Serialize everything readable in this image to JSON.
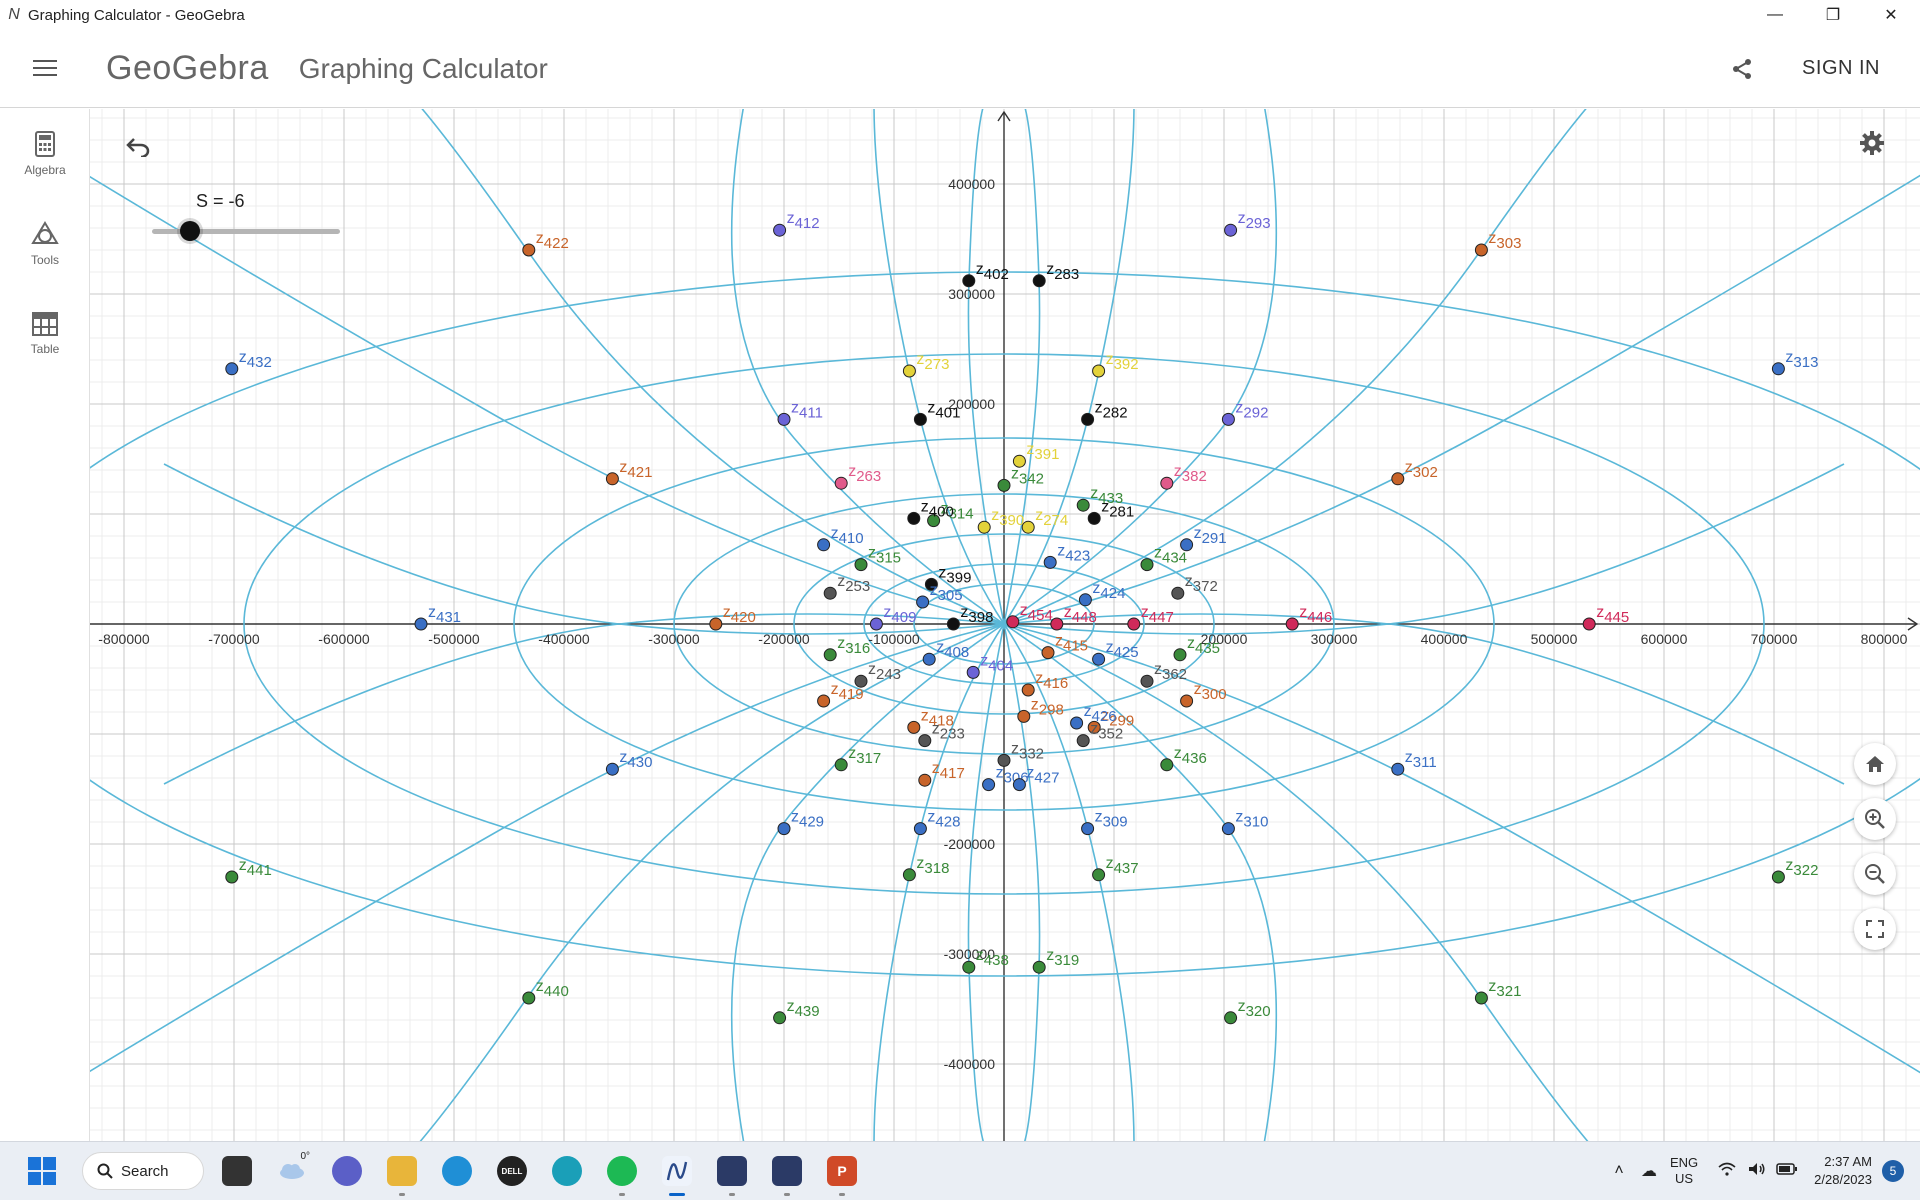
{
  "window": {
    "title": "Graphing Calculator - GeoGebra",
    "app_glyph": "N"
  },
  "header": {
    "brand": "GeoGebra",
    "app_name": "Graphing Calculator",
    "signin_label": "SIGN IN"
  },
  "sidebar": {
    "items": [
      {
        "label": "Algebra",
        "icon": "calculator-icon"
      },
      {
        "label": "Tools",
        "icon": "tools-icon"
      },
      {
        "label": "Table",
        "icon": "table-icon"
      }
    ]
  },
  "slider": {
    "label": "S = -6",
    "value": -6,
    "min": -10,
    "max": 10
  },
  "axes": {
    "x_ticks": [
      "-800000",
      "-700000",
      "-600000",
      "-500000",
      "-400000",
      "-300000",
      "-200000",
      "-100000",
      "200000",
      "300000",
      "400000",
      "500000",
      "600000",
      "700000",
      "800000"
    ],
    "y_ticks": [
      "400000",
      "300000",
      "200000",
      "-200000",
      "-300000",
      "-400000"
    ]
  },
  "points": [
    {
      "label": "z",
      "sub": "412",
      "x": -204000,
      "y": 358000,
      "color": "#6b63d6"
    },
    {
      "label": "z",
      "sub": "422",
      "x": -432000,
      "y": 340000,
      "color": "#c8642a"
    },
    {
      "label": "z",
      "sub": "432",
      "x": -702000,
      "y": 232000,
      "color": "#3a6fc4"
    },
    {
      "label": "z",
      "sub": "421",
      "x": -356000,
      "y": 132000,
      "color": "#c8642a"
    },
    {
      "label": "z",
      "sub": "431",
      "x": -530000,
      "y": 0,
      "color": "#3a6fc4"
    },
    {
      "label": "z",
      "sub": "420",
      "x": -262000,
      "y": 0,
      "color": "#c8642a"
    },
    {
      "label": "z",
      "sub": "430",
      "x": -356000,
      "y": -132000,
      "color": "#3a6fc4"
    },
    {
      "label": "z",
      "sub": "441",
      "x": -702000,
      "y": -230000,
      "color": "#3a8a3a"
    },
    {
      "label": "z",
      "sub": "440",
      "x": -432000,
      "y": -340000,
      "color": "#3a8a3a"
    },
    {
      "label": "z",
      "sub": "439",
      "x": -204000,
      "y": -358000,
      "color": "#3a8a3a"
    },
    {
      "label": "z",
      "sub": "429",
      "x": -200000,
      "y": -186000,
      "color": "#3a6fc4"
    },
    {
      "label": "z",
      "sub": "411",
      "x": -200000,
      "y": 186000,
      "color": "#6b63d6"
    },
    {
      "label": "z",
      "sub": "402",
      "x": -32000,
      "y": 312000,
      "color": "#111111"
    },
    {
      "label": "z",
      "sub": "283",
      "x": 32000,
      "y": 312000,
      "color": "#111111"
    },
    {
      "label": "z",
      "sub": "293",
      "x": 206000,
      "y": 358000,
      "color": "#6b63d6"
    },
    {
      "label": "z",
      "sub": "303",
      "x": 434000,
      "y": 340000,
      "color": "#c8642a"
    },
    {
      "label": "z",
      "sub": "313",
      "x": 704000,
      "y": 232000,
      "color": "#3a6fc4"
    },
    {
      "label": "z",
      "sub": "292",
      "x": 204000,
      "y": 186000,
      "color": "#6b63d6"
    },
    {
      "label": "z",
      "sub": "302",
      "x": 358000,
      "y": 132000,
      "color": "#c8642a"
    },
    {
      "label": "z",
      "sub": "446",
      "x": 262000,
      "y": 0,
      "color": "#d02a5a"
    },
    {
      "label": "z",
      "sub": "445",
      "x": 532000,
      "y": 0,
      "color": "#d02a5a"
    },
    {
      "label": "z",
      "sub": "311",
      "x": 358000,
      "y": -132000,
      "color": "#3a6fc4"
    },
    {
      "label": "z",
      "sub": "322",
      "x": 704000,
      "y": -230000,
      "color": "#3a8a3a"
    },
    {
      "label": "z",
      "sub": "321",
      "x": 434000,
      "y": -340000,
      "color": "#3a8a3a"
    },
    {
      "label": "z",
      "sub": "320",
      "x": 206000,
      "y": -358000,
      "color": "#3a8a3a"
    },
    {
      "label": "z",
      "sub": "310",
      "x": 204000,
      "y": -186000,
      "color": "#3a6fc4"
    },
    {
      "label": "z",
      "sub": "438",
      "x": -32000,
      "y": -312000,
      "color": "#3a8a3a"
    },
    {
      "label": "z",
      "sub": "319",
      "x": 32000,
      "y": -312000,
      "color": "#3a8a3a"
    },
    {
      "label": "z",
      "sub": "273",
      "x": -86000,
      "y": 230000,
      "color": "#e3d23a"
    },
    {
      "label": "z",
      "sub": "392",
      "x": 86000,
      "y": 230000,
      "color": "#e3d23a"
    },
    {
      "label": "z",
      "sub": "401",
      "x": -76000,
      "y": 186000,
      "color": "#111111"
    },
    {
      "label": "z",
      "sub": "282",
      "x": 76000,
      "y": 186000,
      "color": "#111111"
    },
    {
      "label": "z",
      "sub": "263",
      "x": -148000,
      "y": 128000,
      "color": "#e05a8a"
    },
    {
      "label": "z",
      "sub": "382",
      "x": 148000,
      "y": 128000,
      "color": "#e05a8a"
    },
    {
      "label": "z",
      "sub": "391",
      "x": 14000,
      "y": 148000,
      "color": "#e3d23a"
    },
    {
      "label": "z",
      "sub": "342",
      "x": 0,
      "y": 126000,
      "color": "#3a8a3a"
    },
    {
      "label": "z",
      "sub": "314",
      "x": -64000,
      "y": 94000,
      "color": "#3a8a3a"
    },
    {
      "label": "z",
      "sub": "433",
      "x": 72000,
      "y": 108000,
      "color": "#3a8a3a"
    },
    {
      "label": "z",
      "sub": "400",
      "x": -82000,
      "y": 96000,
      "color": "#111111"
    },
    {
      "label": "z",
      "sub": "281",
      "x": 82000,
      "y": 96000,
      "color": "#111111"
    },
    {
      "label": "z",
      "sub": "410",
      "x": -164000,
      "y": 72000,
      "color": "#3a6fc4"
    },
    {
      "label": "z",
      "sub": "291",
      "x": 166000,
      "y": 72000,
      "color": "#3a6fc4"
    },
    {
      "label": "z",
      "sub": "315",
      "x": -130000,
      "y": 54000,
      "color": "#3a8a3a"
    },
    {
      "label": "z",
      "sub": "434",
      "x": 130000,
      "y": 54000,
      "color": "#3a8a3a"
    },
    {
      "label": "z",
      "sub": "390",
      "x": -18000,
      "y": 88000,
      "color": "#e3d23a"
    },
    {
      "label": "z",
      "sub": "274",
      "x": 22000,
      "y": 88000,
      "color": "#e3d23a"
    },
    {
      "label": "z",
      "sub": "253",
      "x": -158000,
      "y": 28000,
      "color": "#555555"
    },
    {
      "label": "z",
      "sub": "372",
      "x": 158000,
      "y": 28000,
      "color": "#555555"
    },
    {
      "label": "z",
      "sub": "399",
      "x": -66000,
      "y": 36000,
      "color": "#111111"
    },
    {
      "label": "z",
      "sub": "423",
      "x": 42000,
      "y": 56000,
      "color": "#3a6fc4"
    },
    {
      "label": "z",
      "sub": "424",
      "x": 74000,
      "y": 22000,
      "color": "#3a6fc4"
    },
    {
      "label": "z",
      "sub": "409",
      "x": -116000,
      "y": 0,
      "color": "#6b63d6"
    },
    {
      "label": "z",
      "sub": "447",
      "x": 118000,
      "y": 0,
      "color": "#d02a5a"
    },
    {
      "label": "z",
      "sub": "305",
      "x": -74000,
      "y": 20000,
      "color": "#3a6fc4"
    },
    {
      "label": "z",
      "sub": "398",
      "x": -46000,
      "y": 0,
      "color": "#111111"
    },
    {
      "label": "z",
      "sub": "454",
      "x": 8000,
      "y": 2000,
      "color": "#d02a5a"
    },
    {
      "label": "z",
      "sub": "448",
      "x": 48000,
      "y": 0,
      "color": "#d02a5a"
    },
    {
      "label": "z",
      "sub": "415",
      "x": 40000,
      "y": -26000,
      "color": "#c8642a"
    },
    {
      "label": "z",
      "sub": "316",
      "x": -158000,
      "y": -28000,
      "color": "#3a8a3a"
    },
    {
      "label": "z",
      "sub": "435",
      "x": 160000,
      "y": -28000,
      "color": "#3a8a3a"
    },
    {
      "label": "z",
      "sub": "425",
      "x": 86000,
      "y": -32000,
      "color": "#3a6fc4"
    },
    {
      "label": "z",
      "sub": "408",
      "x": -68000,
      "y": -32000,
      "color": "#3a6fc4"
    },
    {
      "label": "z",
      "sub": "243",
      "x": -130000,
      "y": -52000,
      "color": "#555555"
    },
    {
      "label": "z",
      "sub": "362",
      "x": 130000,
      "y": -52000,
      "color": "#555555"
    },
    {
      "label": "z",
      "sub": "404",
      "x": -28000,
      "y": -44000,
      "color": "#6b63d6"
    },
    {
      "label": "z",
      "sub": "416",
      "x": 22000,
      "y": -60000,
      "color": "#c8642a"
    },
    {
      "label": "z",
      "sub": "419",
      "x": -164000,
      "y": -70000,
      "color": "#c8642a"
    },
    {
      "label": "z",
      "sub": "300",
      "x": 166000,
      "y": -70000,
      "color": "#c8642a"
    },
    {
      "label": "z",
      "sub": "298",
      "x": 18000,
      "y": -84000,
      "color": "#c8642a"
    },
    {
      "label": "z",
      "sub": "418",
      "x": -82000,
      "y": -94000,
      "color": "#c8642a"
    },
    {
      "label": "z",
      "sub": "299",
      "x": 82000,
      "y": -94000,
      "color": "#c8642a"
    },
    {
      "label": "z",
      "sub": "233",
      "x": -72000,
      "y": -106000,
      "color": "#555555"
    },
    {
      "label": "z",
      "sub": "352",
      "x": 72000,
      "y": -106000,
      "color": "#555555"
    },
    {
      "label": "z",
      "sub": "426",
      "x": 66000,
      "y": -90000,
      "color": "#3a6fc4"
    },
    {
      "label": "z",
      "sub": "317",
      "x": -148000,
      "y": -128000,
      "color": "#3a8a3a"
    },
    {
      "label": "z",
      "sub": "436",
      "x": 148000,
      "y": -128000,
      "color": "#3a8a3a"
    },
    {
      "label": "z",
      "sub": "417",
      "x": -72000,
      "y": -142000,
      "color": "#c8642a"
    },
    {
      "label": "z",
      "sub": "332",
      "x": 0,
      "y": -124000,
      "color": "#555555"
    },
    {
      "label": "z",
      "sub": "306",
      "x": -14000,
      "y": -146000,
      "color": "#3a6fc4"
    },
    {
      "label": "z",
      "sub": "427",
      "x": 14000,
      "y": -146000,
      "color": "#3a6fc4"
    },
    {
      "label": "z",
      "sub": "428",
      "x": -76000,
      "y": -186000,
      "color": "#3a6fc4"
    },
    {
      "label": "z",
      "sub": "309",
      "x": 76000,
      "y": -186000,
      "color": "#3a6fc4"
    },
    {
      "label": "z",
      "sub": "318",
      "x": -86000,
      "y": -228000,
      "color": "#3a8a3a"
    },
    {
      "label": "z",
      "sub": "437",
      "x": 86000,
      "y": -228000,
      "color": "#3a8a3a"
    }
  ],
  "taskbar": {
    "search_label": "Search",
    "weather_temp": "0°",
    "apps": [
      {
        "name": "file-manager-icon",
        "color": "#333333",
        "glyph": ""
      },
      {
        "name": "teams-icon",
        "color": "#5b5fc7",
        "glyph": ""
      },
      {
        "name": "folder-icon",
        "color": "#e8b53a",
        "glyph": ""
      },
      {
        "name": "edge-icon",
        "color": "#1f8fd6",
        "glyph": ""
      },
      {
        "name": "dell-icon",
        "color": "#222222",
        "glyph": "DELL"
      },
      {
        "name": "circle-app-icon",
        "color": "#1a9fb8",
        "glyph": ""
      },
      {
        "name": "spotify-icon",
        "color": "#1db954",
        "glyph": ""
      },
      {
        "name": "geogebra-icon",
        "color": "#eef3fb",
        "glyph": ""
      },
      {
        "name": "app-dark-icon",
        "color": "#2b3a66",
        "glyph": ""
      },
      {
        "name": "app-dark2-icon",
        "color": "#2b3a66",
        "glyph": ""
      },
      {
        "name": "powerpoint-icon",
        "color": "#d04a28",
        "glyph": "P"
      }
    ],
    "lang_top": "ENG",
    "lang_bottom": "US",
    "time": "2:37 AM",
    "date": "2/28/2023",
    "notifications": "5"
  },
  "colors": {
    "curve": "#5ab8d8",
    "axis": "#333333",
    "grid_major": "#c8c8c8",
    "grid_minor": "#ececec"
  }
}
